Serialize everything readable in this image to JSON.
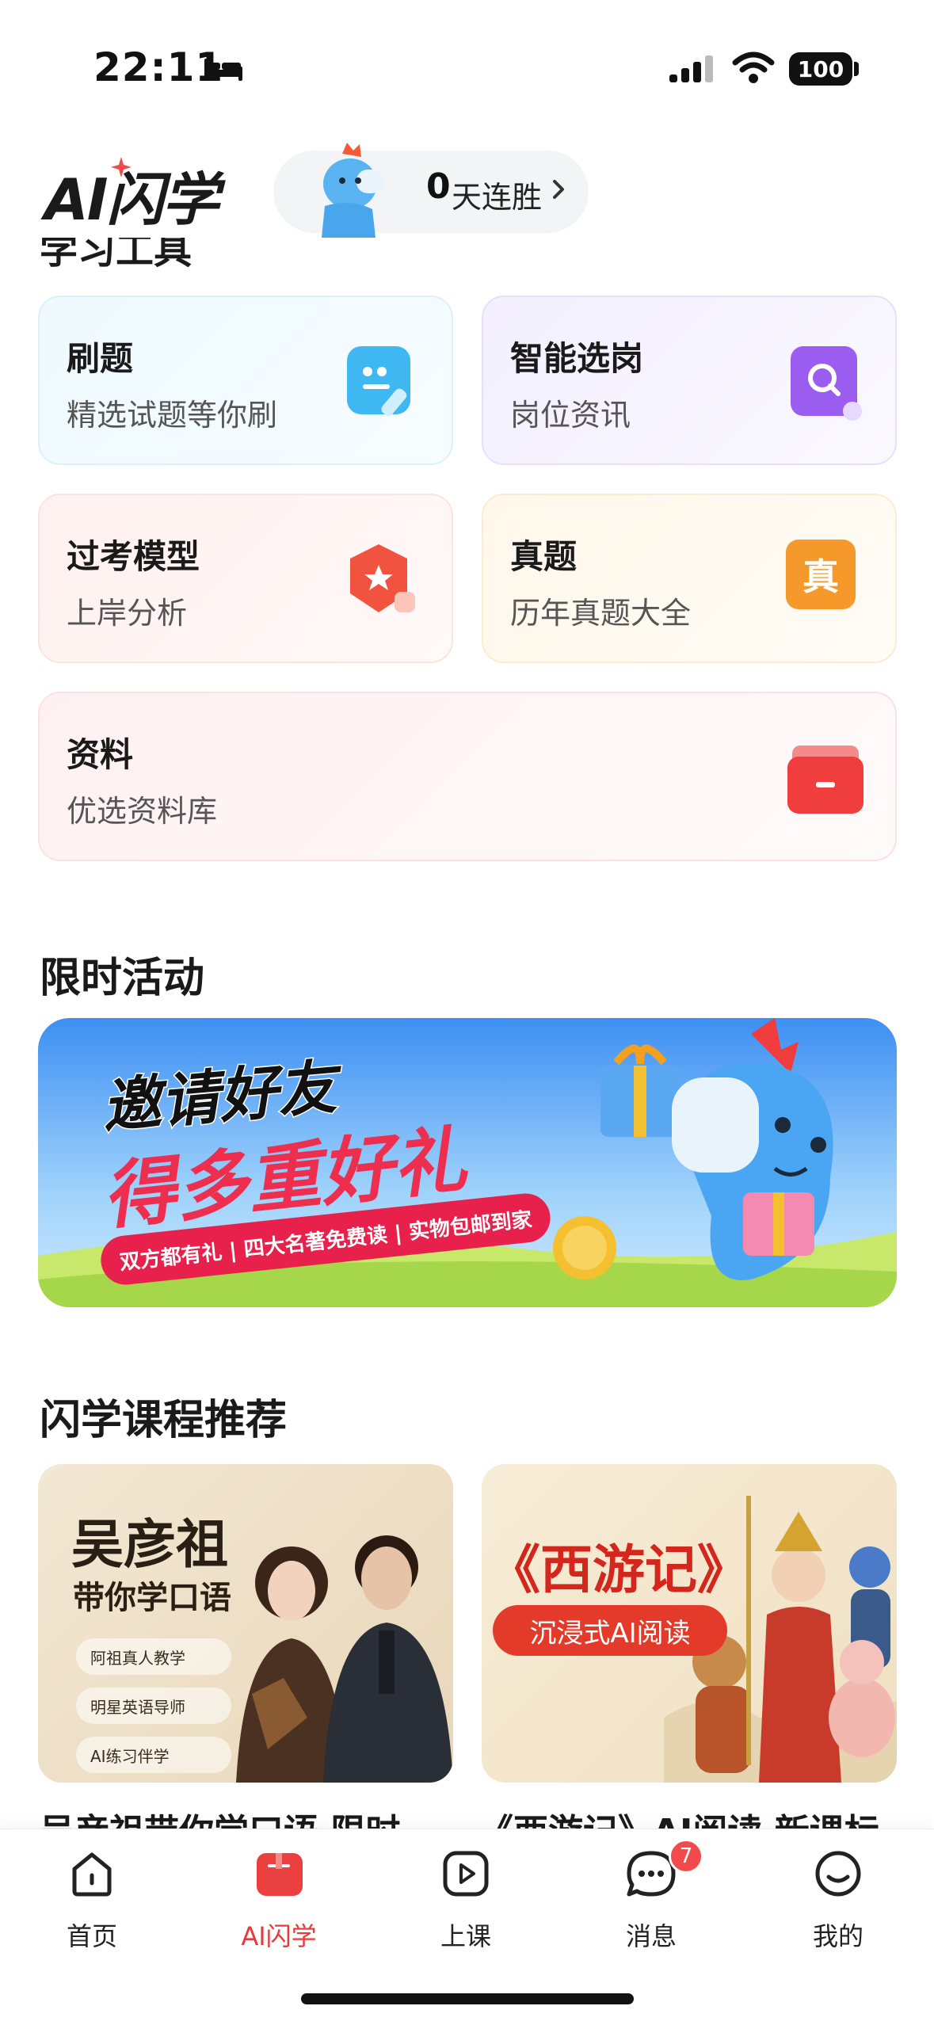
{
  "status_bar": {
    "time": "22:11",
    "battery": "100"
  },
  "header": {
    "logo": "AI闪学",
    "streak_count": "0",
    "streak_label": "天连胜"
  },
  "tools_section": {
    "title": "学习工具"
  },
  "tools": [
    {
      "title": "刷题",
      "subtitle": "精选试题等你刷"
    },
    {
      "title": "智能选岗",
      "subtitle": "岗位资讯"
    },
    {
      "title": "过考模型",
      "subtitle": "上岸分析"
    },
    {
      "title": "真题",
      "subtitle": "历年真题大全",
      "icon_text": "真"
    },
    {
      "title": "资料",
      "subtitle": "优选资料库"
    }
  ],
  "activity_section": {
    "title": "限时活动"
  },
  "banner": {
    "line1": "邀请好友",
    "line2": "得多重好礼",
    "ribbon": "双方都有礼 | 四大名著免费读 | 实物包邮到家"
  },
  "course_section": {
    "title": "闪学课程推荐"
  },
  "courses": [
    {
      "cover_title": "吴彦祖",
      "cover_subtitle": "带你学口语",
      "tags": [
        "阿祖真人教学",
        "明星英语导师",
        "AI练习伴学"
      ],
      "caption": "吴彦祖带你学口语 限时"
    },
    {
      "cover_title": "《西游记》",
      "cover_subtitle": "沉浸式AI阅读",
      "caption": "《西游记》AI阅读 新课标"
    }
  ],
  "tab_bar": {
    "tabs": [
      {
        "label": "首页",
        "icon": "home-icon"
      },
      {
        "label": "AI闪学",
        "icon": "book-icon"
      },
      {
        "label": "上课",
        "icon": "play-icon"
      },
      {
        "label": "消息",
        "icon": "chat-icon",
        "badge": "7"
      },
      {
        "label": "我的",
        "icon": "profile-icon"
      }
    ],
    "active_tab": "AI闪学",
    "accent_color": "#e83a3a"
  }
}
